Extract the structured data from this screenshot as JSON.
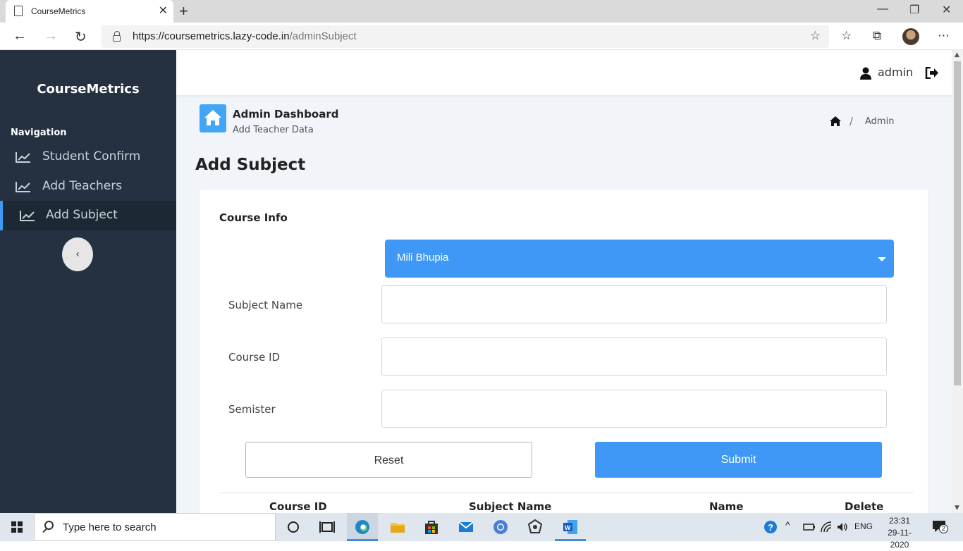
{
  "browser": {
    "tab_title": "CourseMetrics",
    "url_host": "https://coursemetrics.lazy-code.in",
    "url_path": "/adminSubject"
  },
  "sidebar": {
    "brand": "CourseMetrics",
    "nav_label": "Navigation",
    "items": [
      {
        "label": "Student Confirm",
        "icon": "line-chart-icon",
        "active": false
      },
      {
        "label": "Add Teachers",
        "icon": "line-chart-icon",
        "active": false
      },
      {
        "label": "Add Subject",
        "icon": "line-chart-icon",
        "active": true
      }
    ]
  },
  "header": {
    "username": "admin"
  },
  "page": {
    "dashboard_title": "Admin Dashboard",
    "dashboard_subtitle": "Add Teacher Data",
    "breadcrumb": {
      "separator": "/",
      "current": "Admin"
    },
    "title": "Add Subject"
  },
  "form": {
    "section_title": "Course Info",
    "teacher_select_value": "Mili Bhupia",
    "fields": [
      {
        "label": "Subject Name",
        "value": ""
      },
      {
        "label": "Course ID",
        "value": ""
      },
      {
        "label": "Semister",
        "value": ""
      }
    ],
    "reset_label": "Reset",
    "submit_label": "Submit"
  },
  "table": {
    "headers": [
      "Course ID",
      "Subject Name",
      "Name",
      "Delete"
    ]
  },
  "taskbar": {
    "search_placeholder": "Type here to search",
    "language": "ENG",
    "time": "23:31",
    "date": "29-11-2020",
    "notification_count": "2"
  },
  "colors": {
    "sidebar_bg": "#253141",
    "accent_blue": "#3f98f5",
    "page_bg": "#f1f5f9"
  }
}
